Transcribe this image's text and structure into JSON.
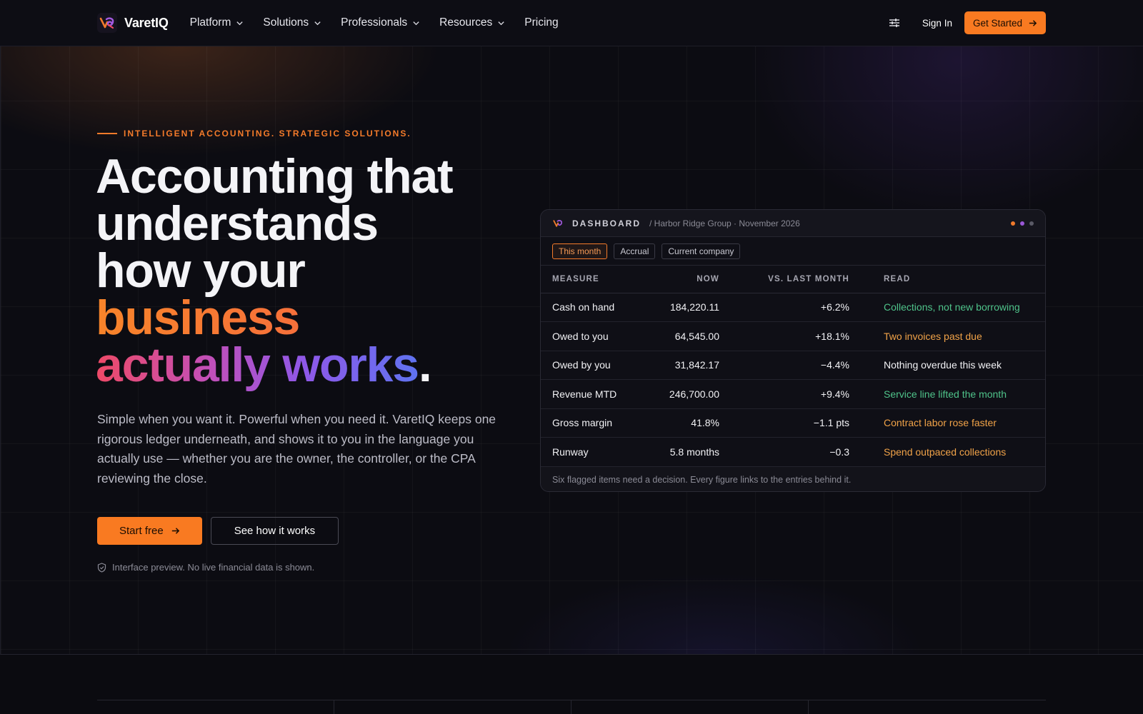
{
  "nav": {
    "brand": "VaretIQ",
    "links": [
      {
        "label": "Platform",
        "dropdown": true
      },
      {
        "label": "Solutions",
        "dropdown": true
      },
      {
        "label": "Professionals",
        "dropdown": true
      },
      {
        "label": "Resources",
        "dropdown": true
      },
      {
        "label": "Pricing",
        "dropdown": false
      }
    ],
    "settings_icon": "sliders-icon",
    "sign_in": "Sign In",
    "get_started": "Get Started"
  },
  "hero": {
    "eyebrow": "INTELLIGENT ACCOUNTING. STRATEGIC SOLUTIONS.",
    "headline": {
      "line1": "Accounting that",
      "line2": "understands",
      "line3": "how your",
      "line4": "business",
      "line5": "actually works",
      "period": "."
    },
    "lede": "Simple when you want it. Powerful when you need it. VaretIQ keeps one rigorous ledger underneath, and shows it to you in the language you actually use — whether you are the owner, the controller, or the CPA reviewing the close.",
    "primary_cta": "Start free",
    "secondary_cta": "See how it works",
    "disclaimer": "Interface preview. No live financial data is shown."
  },
  "dashboard": {
    "title": "DASHBOARD",
    "subtitle": "/ Harbor Ridge Group · November 2026",
    "dots": [
      "#f07a2c",
      "#9a57d6",
      "#5a5a66"
    ],
    "filters": [
      {
        "label": "This month",
        "active": true
      },
      {
        "label": "Accrual",
        "active": false
      },
      {
        "label": "Current company",
        "active": false
      }
    ],
    "columns": {
      "measure": "MEASURE",
      "now": "NOW",
      "vs": "VS. LAST MONTH",
      "read": "READ"
    },
    "rows": [
      {
        "measure": "Cash on hand",
        "now": "184,220.11",
        "vs": "+6.2%",
        "read": "Collections, not new borrowing",
        "tone": "good"
      },
      {
        "measure": "Owed to you",
        "now": "64,545.00",
        "vs": "+18.1%",
        "read": "Two invoices past due",
        "tone": "warn"
      },
      {
        "measure": "Owed by you",
        "now": "31,842.17",
        "vs": "−4.4%",
        "read": "Nothing overdue this week",
        "tone": "neutral"
      },
      {
        "measure": "Revenue MTD",
        "now": "246,700.00",
        "vs": "+9.4%",
        "read": "Service line lifted the month",
        "tone": "good"
      },
      {
        "measure": "Gross margin",
        "now": "41.8%",
        "vs": "−1.1 pts",
        "read": "Contract labor rose faster",
        "tone": "warn"
      },
      {
        "measure": "Runway",
        "now": "5.8 months",
        "vs": "−0.3",
        "read": "Spend outpaced collections",
        "tone": "warn"
      }
    ],
    "footer": "Six flagged items need a decision. Every figure links to the entries behind it."
  },
  "colors": {
    "accent": "#f97a21",
    "good": "#4fc38a",
    "warn": "#f0a248"
  }
}
